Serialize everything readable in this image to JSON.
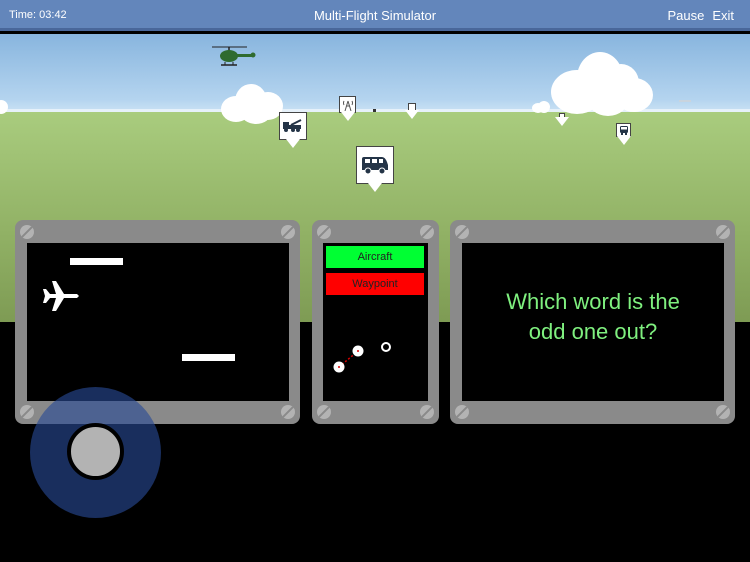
{
  "header": {
    "time_label": "Time: 03:42",
    "title": "Multi-Flight Simulator",
    "pause_label": "Pause",
    "exit_label": "Exit"
  },
  "scene": {
    "icons": {
      "helicopter": "helicopter-icon",
      "tow_truck": "tow-truck-icon",
      "radio_tower": "radio-tower-icon",
      "van": "van-icon",
      "bus": "bus-icon"
    }
  },
  "tracking_panel": {
    "aircraft_icon": "airplane-icon"
  },
  "radar_panel": {
    "aircraft_label": "Aircraft",
    "waypoint_label": "Waypoint",
    "aircraft_color": "#00ff33",
    "waypoint_color": "#ff0000"
  },
  "question_panel": {
    "question_line1": "Which word is the",
    "question_line2": "odd one out?",
    "text_color": "#7ff07f"
  },
  "colors": {
    "topbar": "#6386bb",
    "joystick": "#284b96",
    "panel_frame": "#8a8a8a"
  }
}
